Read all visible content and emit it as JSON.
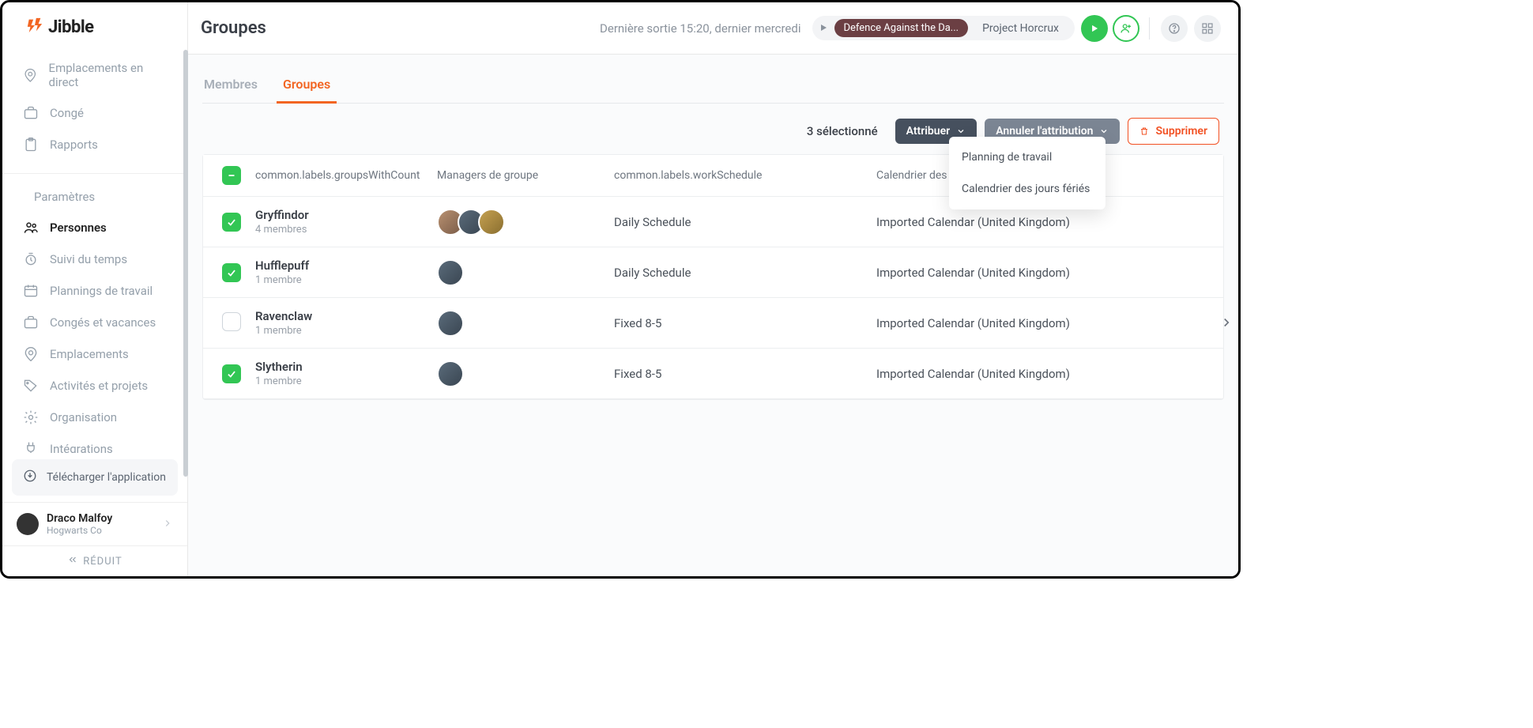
{
  "brand": {
    "name": "Jibble"
  },
  "sidebar": {
    "items": [
      {
        "label": "Emplacements en direct",
        "icon": "location"
      },
      {
        "label": "Congé",
        "icon": "briefcase"
      },
      {
        "label": "Rapports",
        "icon": "clipboard"
      }
    ],
    "settings_label": "Paramètres",
    "items2": [
      {
        "label": "Personnes",
        "active": true,
        "icon": "people"
      },
      {
        "label": "Suivi du temps",
        "icon": "timer"
      },
      {
        "label": "Plannings de travail",
        "icon": "schedule"
      },
      {
        "label": "Congés et vacances",
        "icon": "briefcase"
      },
      {
        "label": "Emplacements",
        "icon": "location"
      },
      {
        "label": "Activités et projets",
        "icon": "tag"
      },
      {
        "label": "Organisation",
        "icon": "gear"
      },
      {
        "label": "Intégrations",
        "icon": "plug"
      }
    ],
    "download_label": "Télécharger l'application",
    "user": {
      "name": "Draco Malfoy",
      "org": "Hogwarts Co"
    },
    "collapse_label": "RÉDUIT"
  },
  "header": {
    "title": "Groupes",
    "last_out": "Dernière sortie 15:20, dernier mercredi",
    "chip_activity": "Defence Against the Da...",
    "chip_project": "Project Horcrux"
  },
  "tabs": {
    "members": "Membres",
    "groups": "Groupes"
  },
  "actions": {
    "selected_text": "3 sélectionné",
    "assign": "Attribuer",
    "unassign": "Annuler l'attribution",
    "delete": "Supprimer"
  },
  "table": {
    "headers": {
      "groups": "common.labels.groupsWithCount",
      "managers": "Managers de groupe",
      "schedule": "common.labels.workSchedule",
      "calendar": "Calendrier des jours fériés"
    },
    "rows": [
      {
        "name": "Gryffindor",
        "sub": "4 membres",
        "avatars": 3,
        "schedule": "Daily Schedule",
        "calendar": "Imported Calendar (United Kingdom)",
        "checked": true
      },
      {
        "name": "Hufflepuff",
        "sub": "1 membre",
        "avatars": 1,
        "schedule": "Daily Schedule",
        "calendar": "Imported Calendar (United Kingdom)",
        "checked": true
      },
      {
        "name": "Ravenclaw",
        "sub": "1 membre",
        "avatars": 1,
        "schedule": "Fixed 8-5",
        "calendar": "Imported Calendar (United Kingdom)",
        "checked": false
      },
      {
        "name": "Slytherin",
        "sub": "1 membre",
        "avatars": 1,
        "schedule": "Fixed 8-5",
        "calendar": "Imported Calendar (United Kingdom)",
        "checked": true
      }
    ]
  },
  "dropdown": {
    "items": [
      "Planning de travail",
      "Calendrier des jours fériés"
    ]
  }
}
